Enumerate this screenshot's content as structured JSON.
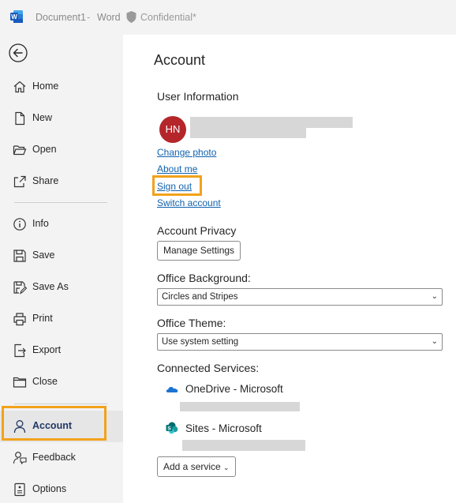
{
  "titlebar": {
    "document": "Document1",
    "separator": "-",
    "app": "Word",
    "sensitivity_label": "Confidential*"
  },
  "nav": {
    "items": [
      {
        "label": "Home",
        "icon": "home-icon"
      },
      {
        "label": "New",
        "icon": "new-document-icon"
      },
      {
        "label": "Open",
        "icon": "folder-open-icon"
      },
      {
        "label": "Share",
        "icon": "share-icon"
      },
      {
        "label": "Info",
        "icon": "info-icon"
      },
      {
        "label": "Save",
        "icon": "save-icon"
      },
      {
        "label": "Save As",
        "icon": "save-as-icon"
      },
      {
        "label": "Print",
        "icon": "printer-icon"
      },
      {
        "label": "Export",
        "icon": "export-icon"
      },
      {
        "label": "Close",
        "icon": "close-folder-icon"
      },
      {
        "label": "Account",
        "icon": "person-icon",
        "active": true
      },
      {
        "label": "Feedback",
        "icon": "feedback-icon"
      },
      {
        "label": "Options",
        "icon": "options-icon"
      }
    ]
  },
  "main": {
    "title": "Account",
    "user_info": {
      "heading": "User Information",
      "avatar_initials": "HN",
      "links": {
        "change_photo": "Change photo",
        "about_me": "About me",
        "sign_out": "Sign out",
        "switch_account": "Switch account"
      }
    },
    "privacy": {
      "heading": "Account Privacy",
      "button": "Manage Settings"
    },
    "background": {
      "heading": "Office Background:",
      "value": "Circles and Stripes"
    },
    "theme": {
      "heading": "Office Theme:",
      "value": "Use system setting"
    },
    "services": {
      "heading": "Connected Services:",
      "items": [
        {
          "name": "OneDrive - Microsoft",
          "icon": "onedrive-icon"
        },
        {
          "name": "Sites - Microsoft",
          "icon": "sharepoint-icon"
        }
      ],
      "add_button": "Add a service"
    }
  },
  "colors": {
    "accent_highlight": "#f2a21b",
    "link": "#0f62ae",
    "avatar": "#b4262a",
    "word_blue": "#185abd"
  }
}
